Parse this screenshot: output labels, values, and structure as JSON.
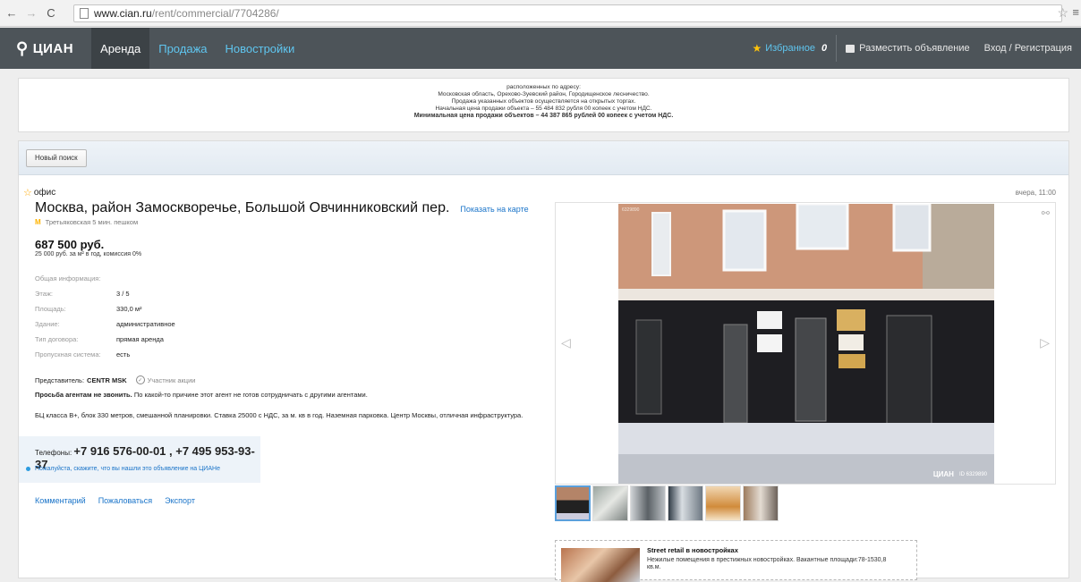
{
  "browser": {
    "url_host": "www.cian.ru",
    "url_path": "/rent/commercial/7704286/"
  },
  "header": {
    "logo": "ЦИАН",
    "tabs": [
      {
        "label": "Аренда",
        "active": true
      },
      {
        "label": "Продажа",
        "active": false
      },
      {
        "label": "Новостройки",
        "active": false
      }
    ],
    "favorites_label": "Избранное",
    "favorites_count": "0",
    "post_ad_label": "Разместить объявление",
    "login_label": "Вход / Регистрация"
  },
  "banner": {
    "lines": [
      "расположенных по адресу:",
      "Московская область, Орехово-Зуевский район, Городищенское лесничество.",
      "Продажа указанных объектов осуществляется на открытых торгах.",
      "Начальная цена продажи объекта – 55 484 832 рубля 00 копеек с учетом НДС."
    ],
    "bold_line": "Минимальная цена продажи объектов – 44 387 865 рублей 00 копеек с учетом НДС."
  },
  "search": {
    "new_search_label": "Новый поиск"
  },
  "listing": {
    "type": "офис",
    "date": "вчера, 11:00",
    "title": "Москва, район Замоскворечье, Большой Овчинниковский пер.",
    "map_link": "Показать на карте",
    "metro_icon": "М",
    "metro": "Третьяковская 5 мин. пешком",
    "price": "687 500 руб.",
    "price_sub": "25 000 руб. за м² в год, комиссия 0%",
    "info_heading": "Общая информация:",
    "info": [
      {
        "label": "Этаж:",
        "value": "3 / 5"
      },
      {
        "label": "Площадь:",
        "value": "330,0 м²"
      },
      {
        "label": "Здание:",
        "value": "административное"
      },
      {
        "label": "Тип договора:",
        "value": "прямая аренда"
      },
      {
        "label": "Пропускная система:",
        "value": "есть"
      }
    ],
    "agent_label": "Представитель:",
    "agent_name": "CENTR MSK",
    "promo_label": "Участник акции",
    "no_agents_bold": "Просьба агентам не звонить.",
    "no_agents_text": "По какой-то причине этот агент не готов сотрудничать с другими агентами.",
    "description": "БЦ класса В+, блок 330 метров, смешанной планировки. Ставка 25000 с НДС, за м. кв в год. Наземная парковка. Центр Москвы, отличная инфраструктура.",
    "phones_label": "Телефоны:",
    "phones": "+7 916 576-00-01 , +7 495 953-93-37",
    "tip": "Пожалуйста, скажите, что вы нашли это объявление на ЦИАНе",
    "actions": [
      "Комментарий",
      "Пожаловаться",
      "Экспорт"
    ]
  },
  "gallery": {
    "photo_id": "6329890",
    "watermark_logo": "ЦИАН",
    "watermark_id": "ID 6329890",
    "thumb_count": 6
  },
  "ad": {
    "title": "Street retail в новостройках",
    "text": "Нежилые помещения в престижных новостройках. Вакантные площади:78-1530,8 кв.м."
  }
}
